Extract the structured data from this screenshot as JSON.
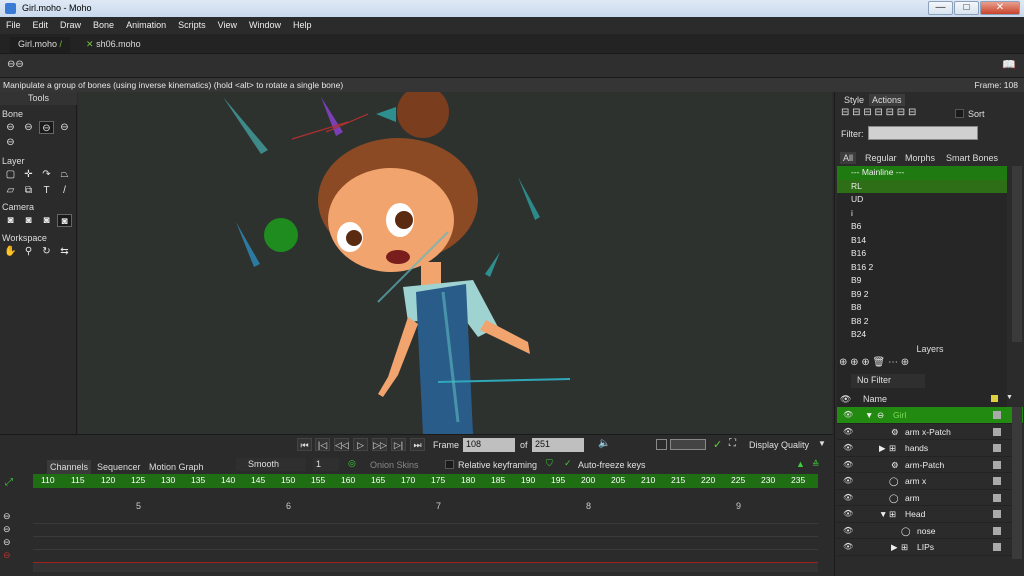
{
  "window": {
    "title": "Girl.moho - Moho",
    "minimize": "—",
    "maximize": "□",
    "close": "✕"
  },
  "menu": [
    "File",
    "Edit",
    "Draw",
    "Bone",
    "Animation",
    "Scripts",
    "View",
    "Window",
    "Help"
  ],
  "doc_tabs": [
    {
      "label": "Girl.moho"
    },
    {
      "label": "sh06.moho"
    }
  ],
  "status": {
    "message": "Manipulate a group of bones (using inverse kinematics) (hold <alt> to rotate a single bone)",
    "frame": "Frame: 108"
  },
  "tools": {
    "title": "Tools",
    "sections": [
      "Bone",
      "Layer",
      "Camera",
      "Workspace"
    ],
    "text_tool": "T"
  },
  "playback": {
    "frame_label": "Frame",
    "frame_value": "108",
    "of_label": "of",
    "total_frames": "251",
    "display_quality": "Display Quality"
  },
  "timeline": {
    "tabs": [
      "Channels",
      "Sequencer",
      "Motion Graph"
    ],
    "interp": "Smooth",
    "interp_count": "1",
    "onion_skins": "Onion Skins",
    "relative_keyframing": "Relative keyframing",
    "auto_freeze": "Auto-freeze keys",
    "ruler": [
      "110",
      "115",
      "120",
      "125",
      "130",
      "135",
      "140",
      "145",
      "150",
      "155",
      "160",
      "165",
      "170",
      "175",
      "180",
      "185",
      "190",
      "195",
      "200",
      "205",
      "210",
      "215",
      "220",
      "225",
      "230",
      "235"
    ],
    "markers": [
      "5",
      "6",
      "7",
      "8",
      "9"
    ]
  },
  "right_panel": {
    "tabs": [
      "Style",
      "Actions"
    ],
    "sort_label": "Sort",
    "filter_label": "Filter:",
    "categories": [
      "All",
      "Regular",
      "Morphs",
      "Smart Bones"
    ],
    "actions": [
      "--- Mainline ---",
      "RL",
      "UD",
      "i",
      "B6",
      "B14",
      "B16",
      "B16 2",
      "B9",
      "B9 2",
      "B8",
      "B8 2",
      "B24"
    ],
    "layers_title": "Layers",
    "no_filter": "No Filter",
    "name_col": "Name",
    "layers": [
      "Girl",
      "arm x-Patch",
      "hands",
      "arm-Patch",
      "arm x",
      "arm",
      "Head",
      "nose",
      "LIPs"
    ]
  },
  "colors": {
    "green_bar": "#1f7a12",
    "selected_layer": "#238a11",
    "canvas_bg": "#2e322f"
  }
}
